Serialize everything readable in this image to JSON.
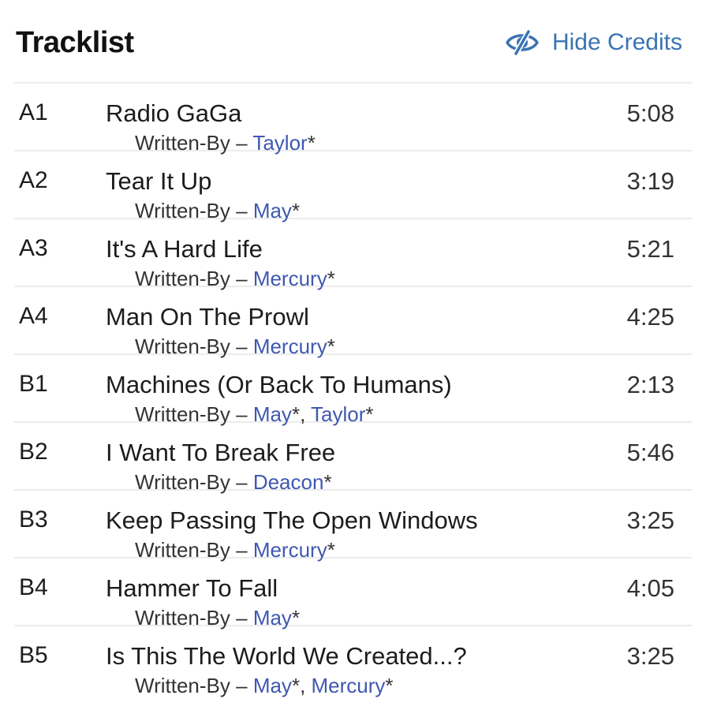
{
  "header": {
    "title": "Tracklist",
    "toggle_label": "Hide Credits",
    "toggle_icon": "eye-slash-icon",
    "accent_color": "#3a73b3"
  },
  "credit_role": "Written-By",
  "credit_dash": "–",
  "link_color": "#3f58b0",
  "tracks": [
    {
      "position": "A1",
      "title": "Radio GaGa",
      "duration": "5:08",
      "writers": [
        "Taylor"
      ]
    },
    {
      "position": "A2",
      "title": "Tear It Up",
      "duration": "3:19",
      "writers": [
        "May"
      ]
    },
    {
      "position": "A3",
      "title": "It's A Hard Life",
      "duration": "5:21",
      "writers": [
        "Mercury"
      ]
    },
    {
      "position": "A4",
      "title": "Man On The Prowl",
      "duration": "4:25",
      "writers": [
        "Mercury"
      ]
    },
    {
      "position": "B1",
      "title": "Machines (Or Back To Humans)",
      "duration": "2:13",
      "writers": [
        "May",
        "Taylor"
      ]
    },
    {
      "position": "B2",
      "title": "I Want To Break Free",
      "duration": "5:46",
      "writers": [
        "Deacon"
      ]
    },
    {
      "position": "B3",
      "title": "Keep Passing The Open Windows",
      "duration": "3:25",
      "writers": [
        "Mercury"
      ]
    },
    {
      "position": "B4",
      "title": "Hammer To Fall",
      "duration": "4:05",
      "writers": [
        "May"
      ]
    },
    {
      "position": "B5",
      "title": "Is This The World We Created...?",
      "duration": "3:25",
      "writers": [
        "May",
        "Mercury"
      ]
    }
  ]
}
